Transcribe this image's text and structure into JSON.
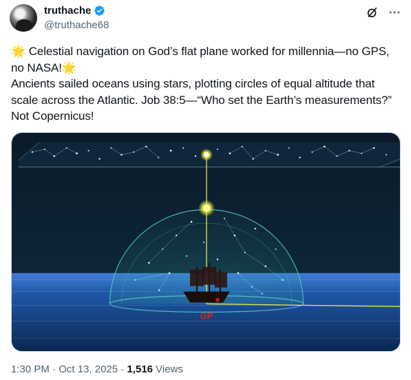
{
  "author": {
    "display_name": "truthache",
    "handle": "@truthache68",
    "verified_color": "#1d9bf0"
  },
  "actions": {
    "grok_icon": "grok-icon",
    "more_icon": "more-icon"
  },
  "tweet": {
    "star_glyph": "🌟",
    "line1": "Celestial navigation on God’s flat plane worked for millennia—no GPS, no NASA!",
    "line2": "Ancients sailed oceans using stars, plotting circles of equal altitude that scale across the Atlantic. Job 38:5—“Who set the Earth’s measurements?” Not Copernicus!"
  },
  "media": {
    "gp_label": "GP"
  },
  "meta": {
    "time": "1:30 PM",
    "separator": " · ",
    "date": "Oct 13, 2025",
    "views_count": "1,516",
    "views_label": " Views"
  }
}
